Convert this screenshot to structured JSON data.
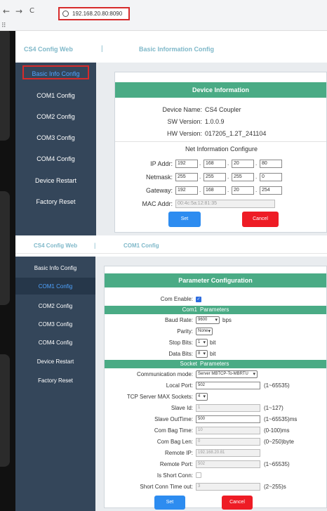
{
  "browser": {
    "back": "←",
    "forward": "→",
    "reload": "C",
    "url": "192.168.20.80:8090",
    "apps": "⠿"
  },
  "top": {
    "brand": "CS4 Config Web",
    "separator": "|",
    "page_title": "Basic Information Config",
    "sidebar": [
      "Basic Info Config",
      "COM1 Config",
      "COM2 Config",
      "COM3 Config",
      "COM4 Config",
      "Device Restart",
      "Factory Reset"
    ],
    "device_card_title": "Device Information",
    "device": {
      "name_label": "Device Name:",
      "name": "CS4 Coupler",
      "sw_label": "SW Version:",
      "sw": "1.0.0.9",
      "hw_label": "HW Version:",
      "hw": "017205_1.2T_241104"
    },
    "net_title": "Net Information Configure",
    "ip_label": "IP Addr:",
    "ip": [
      "192",
      "168",
      "20",
      "80"
    ],
    "mask_label": "Netmask:",
    "mask": [
      "255",
      "255",
      "255",
      "0"
    ],
    "gw_label": "Gateway:",
    "gw": [
      "192",
      "168",
      "20",
      "254"
    ],
    "mac_label": "MAC Addr:",
    "mac": "00:4c:5a:12:81:35",
    "set_button": "Set",
    "cancel_button": "Cancel"
  },
  "bottom": {
    "brand": "CS4 Config Web",
    "separator": "|",
    "page_title": "COM1 Config",
    "sidebar": [
      "Basic Info Config",
      "COM1 Config",
      "COM2 Config",
      "COM3 Config",
      "COM4 Config",
      "Device Restart",
      "Factory Reset"
    ],
    "card_title": "Parameter Configuration",
    "com_enable_label": "Com Enable:",
    "com_section": {
      "left": "Com1",
      "right": "Parameters"
    },
    "baud_label": "Baud Rate:",
    "baud": "9600",
    "baud_unit": "bps",
    "parity_label": "Parity:",
    "parity": "None",
    "stop_label": "Stop Bits:",
    "stop": "1",
    "stop_unit": "bit",
    "data_label": "Data Bits:",
    "data": "8",
    "data_unit": "bit",
    "socket_section": {
      "left": "Socket",
      "right": "Parameters"
    },
    "mode_label": "Communication mode:",
    "mode": "Server MBTCP-To-MBRTU",
    "local_port_label": "Local Port:",
    "local_port": "502",
    "local_port_unit": "(1~65535)",
    "max_sockets_label": "TCP Server MAX Sockets:",
    "max_sockets": "4",
    "slave_id_label": "Slave Id:",
    "slave_id": "1",
    "slave_id_unit": "(1~127)",
    "slave_out_label": "Slave OutTime:",
    "slave_out": "500",
    "slave_out_unit": "(1~65535)ms",
    "bag_time_label": "Com Bag Time:",
    "bag_time": "10",
    "bag_time_unit": "(0-100)ms",
    "bag_len_label": "Com Bag Len:",
    "bag_len": "0",
    "bag_len_unit": "(0~250)byte",
    "remote_ip_label": "Remote IP:",
    "remote_ip": "192.168.20.81",
    "remote_port_label": "Remote Port:",
    "remote_port": "502",
    "remote_port_unit": "(1~65535)",
    "short_conn_label": "Is Short Conn:",
    "short_timeout_label": "Short Conn Time out:",
    "short_timeout": "3",
    "short_timeout_unit": "(2~255)s",
    "set_button": "Set",
    "cancel_button": "Cancel"
  }
}
